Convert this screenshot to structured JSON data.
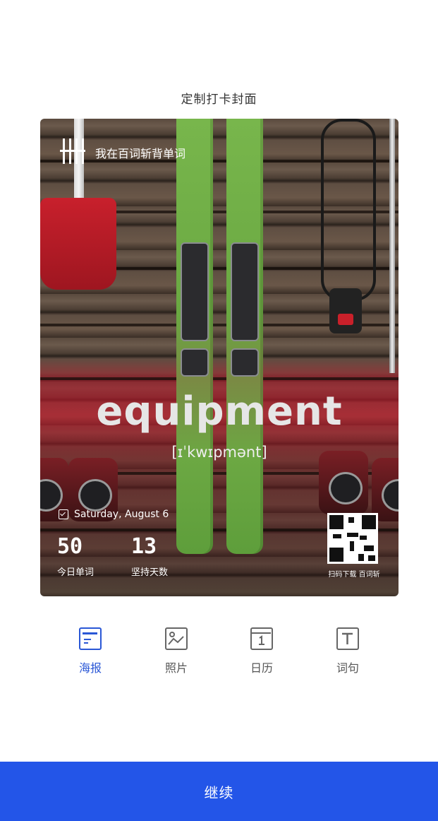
{
  "header": {
    "title": "定制打卡封面"
  },
  "poster": {
    "brand_text": "我在百词斩背单词",
    "word": "equipment",
    "phonetic": "[ɪˈkwɪpmənt]",
    "date": "Saturday, August 6",
    "stats": [
      {
        "value": "50",
        "label": "今日单词"
      },
      {
        "value": "13",
        "label": "坚持天数"
      }
    ],
    "qr_caption": "扫码下载 百词斩"
  },
  "tabs": [
    {
      "label": "海报",
      "icon": "poster-icon",
      "active": true
    },
    {
      "label": "照片",
      "icon": "photo-icon",
      "active": false
    },
    {
      "label": "日历",
      "icon": "calendar-icon",
      "active": false
    },
    {
      "label": "词句",
      "icon": "text-icon",
      "active": false
    }
  ],
  "footer": {
    "continue_label": "继续"
  },
  "colors": {
    "accent": "#2355e8",
    "tab_active": "#2a57d6",
    "tab_inactive": "#555555"
  }
}
